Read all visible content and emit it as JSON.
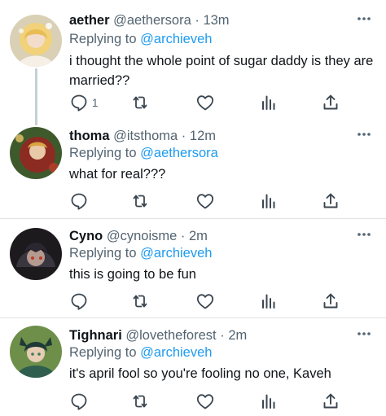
{
  "replies": [
    {
      "name": "aether",
      "handle": "@aethersora",
      "time": "13m",
      "replying_prefix": "Replying to",
      "replying_to": "@archieveh",
      "text_line1": "i thought the whole point of sugar daddy is they are",
      "text_line2": "married??",
      "reply_count": "1"
    },
    {
      "name": "thoma",
      "handle": "@itsthoma",
      "time": "12m",
      "replying_prefix": "Replying to",
      "replying_to": "@aethersora",
      "text_line1": "what for real???",
      "reply_count": ""
    },
    {
      "name": "Cyno",
      "handle": "@cynoisme",
      "time": "2m",
      "replying_prefix": "Replying to",
      "replying_to": "@archieveh",
      "text_line1": "this is going to be fun",
      "reply_count": ""
    },
    {
      "name": "Tighnari",
      "handle": "@lovetheforest",
      "time": "2m",
      "replying_prefix": "Replying to",
      "replying_to": "@archieveh",
      "text_line1": "it's april fool so you're fooling no one, Kaveh",
      "reply_count": ""
    }
  ],
  "separator": "·",
  "colors": {
    "text": "#0f1419",
    "muted": "#536471",
    "link": "#1d9bf0",
    "border": "#dfe3e6",
    "thread_line": "#c4cfd6"
  },
  "icons": {
    "reply": "reply-icon",
    "retweet": "retweet-icon",
    "like": "heart-icon",
    "analytics": "analytics-icon",
    "share": "share-icon",
    "more": "more-icon"
  }
}
